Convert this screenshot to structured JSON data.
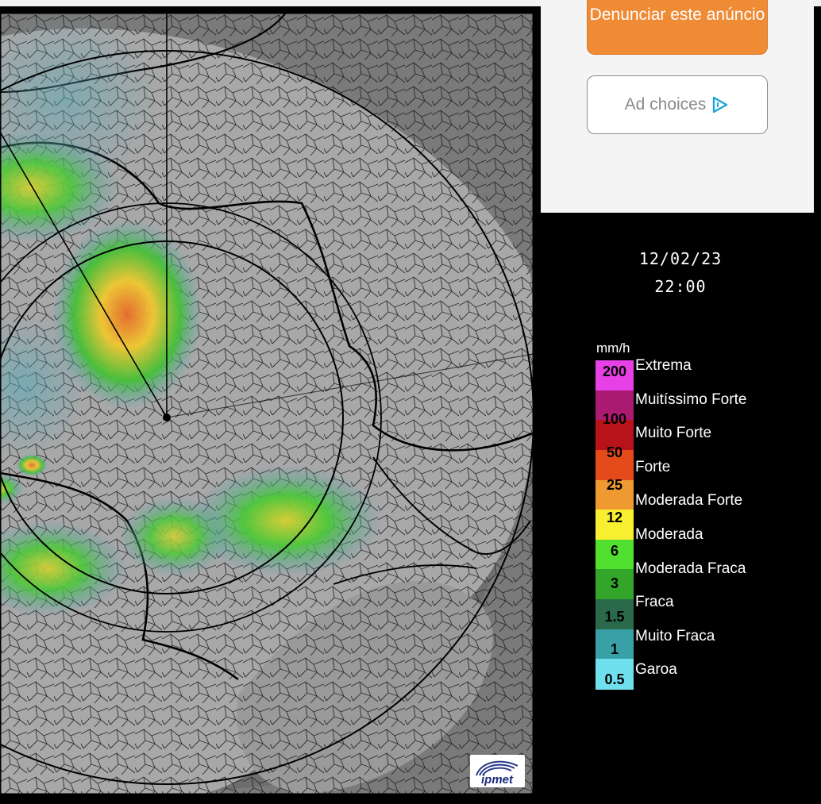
{
  "ad": {
    "report_button": "Denunciar este anúncio",
    "adchoices_label": "Ad choices"
  },
  "radar": {
    "date": "12/02/23",
    "time": "22:00",
    "unit": "mm/h",
    "logo_alt": "ipmet",
    "scale_values": [
      "200",
      "100",
      "50",
      "25",
      "12",
      "6",
      "3",
      "1.5",
      "1",
      "0.5"
    ],
    "categories": [
      "Extrema",
      "Muitíssimo Forte",
      "Muito Forte",
      "Forte",
      "Moderada Forte",
      "Moderada",
      "Moderada Fraca",
      "Fraca",
      "Muito Fraca",
      "Garoa"
    ],
    "scale_colors": [
      "#e640e6",
      "#aa1a70",
      "#b8121a",
      "#e44a1a",
      "#ef9a30",
      "#f8ef30",
      "#52e030",
      "#33a62a",
      "#2a6a4a",
      "#3aa0a8",
      "#6ee0ee"
    ]
  }
}
